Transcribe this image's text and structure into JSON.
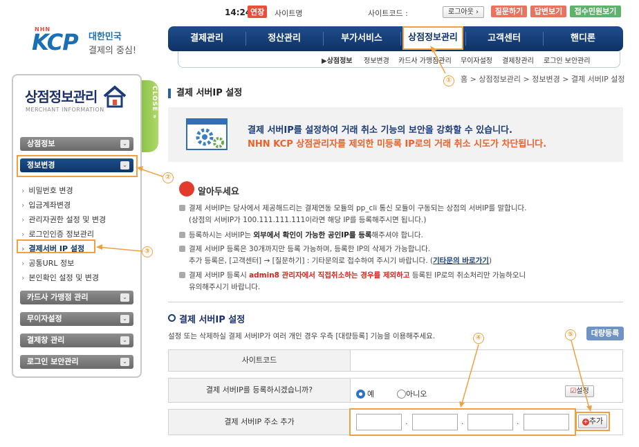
{
  "topbar": {
    "time": "14:24",
    "extend_label": "연장",
    "site_name_label": "사이트명",
    "site_code_label": "사이트코드 :",
    "logout_label": "로그아웃",
    "btn_question": "질문하기",
    "btn_answer": "답변보기",
    "btn_complaint": "접수민원보기"
  },
  "logo": {
    "company": "KCP",
    "company_prefix": "NHN",
    "tagline1": "대한민국",
    "tagline2": "결제의 중심!"
  },
  "gnb": {
    "items": [
      "결제관리",
      "정산관리",
      "부가서비스",
      "상점정보관리",
      "고객센터",
      "핸디론"
    ],
    "active": "상점정보관리"
  },
  "subnav": {
    "items": [
      "▶상점정보",
      "정보변경",
      "카드사 가맹점관리",
      "무이자설정",
      "결제창관리",
      "로그인 보안관리"
    ]
  },
  "breadcrumb": "홈 > 상점정보관리 > 정보변경 > 결제 서버IP 설정",
  "left_panel": {
    "title": "상점정보관리",
    "subtitle": "MERCHANT INFORMATION",
    "close_label": "CLOSE »",
    "menus": [
      {
        "label": "상점정보"
      },
      {
        "label": "정보변경"
      },
      {
        "label": "카드사 가맹점 관리"
      },
      {
        "label": "무이자설정"
      },
      {
        "label": "결제창 관리"
      },
      {
        "label": "로그인 보안관리"
      }
    ],
    "sub_items": [
      "비밀번호 변경",
      "입금계좌변경",
      "관리자권한 설정 및 변경",
      "로그인인증 정보관리",
      "결제서버 IP 설정",
      "공통URL 정보",
      "본인확인 설정 및 변경"
    ],
    "active_sub": "결제서버 IP 설정"
  },
  "page": {
    "title": "결제 서버IP 설정",
    "notice_line1": "결제 서버IP를 설정하여 거래 취소 기능의 보안을 강화할 수 있습니다.",
    "notice_line2": "NHN KCP 상점관리자를 제외한 미등록 IP로의 거래 취소 시도가 차단됩니다.",
    "know_title": "알아두세요",
    "notes": [
      {
        "l1": "결제 서버IP는 당사에서 제공해드리는 결제연동 모듈의 pp_cli 통신 모듈이 구동되는 상점의 서버IP를 말합니다.",
        "l2": "(상점의 서버IP가 100.111.111.111이라면 해당 IP를 등록해주시면 됩니다.)"
      },
      {
        "l1a": "등록하시는 서버IP는 ",
        "l1b": "외부에서 확인이 가능한 공인IP를 등록",
        "l1c": "해주셔야 합니다."
      },
      {
        "l1": "결제 서버IP 등록은 30개까지만 등록 가능하며, 등록한 IP의 삭제가 가능합니다.",
        "l2a": "추가 등록은, [고객센터] → [질문하기] : 기타문의로 접수하여 주시기 바랍니다. (",
        "l2b": "기타문의 바로가기",
        "l2c": ")"
      },
      {
        "l1a": "결제 서버IP 등록시 ",
        "l1b": "admin8 관리자에서 직접취소하는 경우를 제외하고",
        "l1c": " 등록된 IP로의 취소처리만 가능하오니",
        "l2": "유의해주시기 바랍니다."
      }
    ],
    "section_title": "결제 서버IP 설정",
    "section_desc": "설정 또는 삭제하실 결제 서버IP가 여러 개인 경우 우측 [대량등록] 기능을 이용해주세요.",
    "bulk_label": "대량등록",
    "form": {
      "site_code_label": "사이트코드",
      "register_label": "결제 서버IP를 등록하시겠습니까?",
      "yes_label": "예",
      "no_label": "아니오",
      "set_label": "설정",
      "ip_label": "결제 서버IP 주소 추가",
      "add_label": "추가"
    }
  },
  "annotations": [
    "①",
    "②",
    "③",
    "④",
    "⑤"
  ],
  "colors": {
    "accent_orange": "#f0a040",
    "navy": "#0e3266",
    "notice_orange": "#e8622a"
  }
}
